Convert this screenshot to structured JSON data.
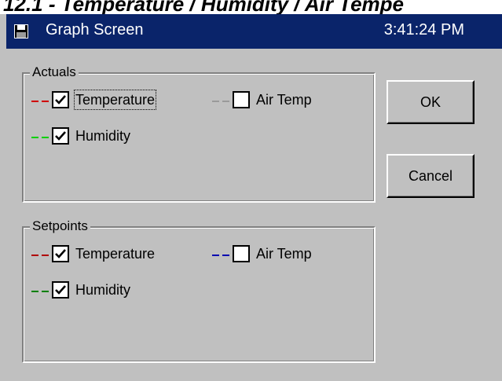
{
  "doc_heading": "12.1 - Temperature / Humidity / Air Tempe",
  "window": {
    "title": "Graph Screen",
    "clock": "3:41:24 PM",
    "icon": "floppy-disk-icon"
  },
  "actuals": {
    "label": "Actuals",
    "items": [
      {
        "label": "Temperature",
        "checked": true,
        "color": "#d00000"
      },
      {
        "label": "Air Temp",
        "checked": false,
        "color": "#9a9a9a"
      },
      {
        "label": "Humidity",
        "checked": true,
        "color": "#00d000"
      }
    ]
  },
  "setpoints": {
    "label": "Setpoints",
    "items": [
      {
        "label": "Temperature",
        "checked": true,
        "color": "#b00000"
      },
      {
        "label": "Air Temp",
        "checked": false,
        "color": "#0000b0"
      },
      {
        "label": "Humidity",
        "checked": true,
        "color": "#008000"
      }
    ]
  },
  "buttons": {
    "ok": "OK",
    "cancel": "Cancel"
  }
}
